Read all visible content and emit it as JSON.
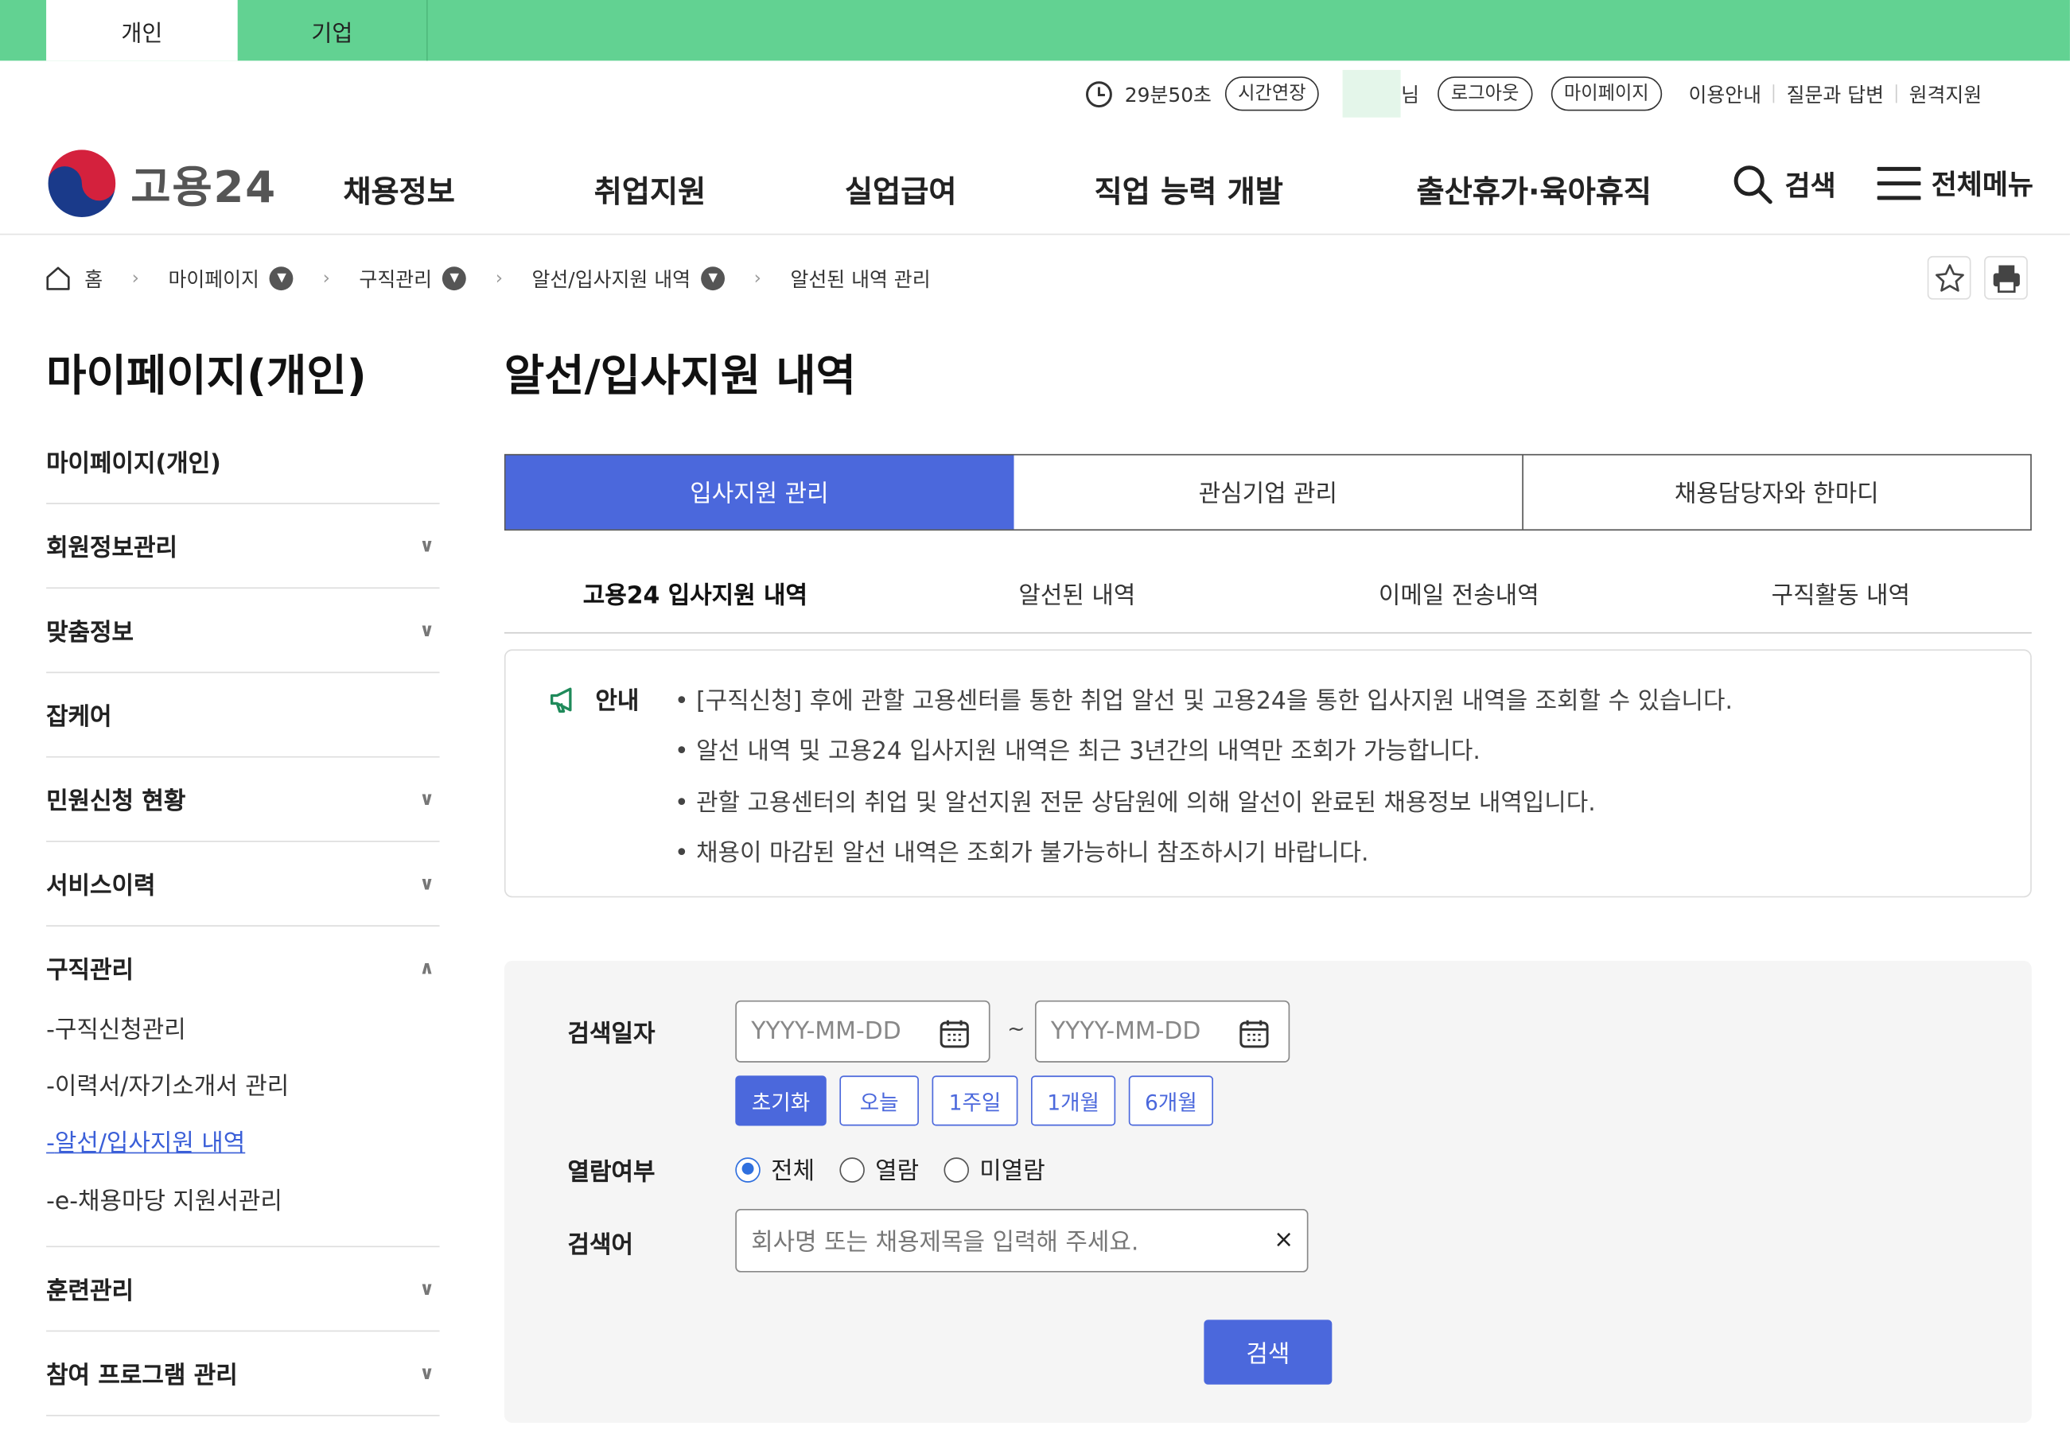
{
  "top_tabs": [
    {
      "label": "개인"
    },
    {
      "label": "기업"
    }
  ],
  "util": {
    "timer": "29분50초",
    "extend": "시간연장",
    "user_suffix": "님",
    "logout": "로그아웃",
    "mypage": "마이페이지",
    "links": [
      "이용안내",
      "질문과 답변",
      "원격지원"
    ]
  },
  "brand": {
    "logo_text": "고용24",
    "logo_colors": [
      "#d4213d",
      "#1a3a8a"
    ]
  },
  "gnb": {
    "items": [
      "채용정보",
      "취업지원",
      "실업급여",
      "직업 능력 개발",
      "출산휴가·육아휴직"
    ],
    "search": "검색",
    "menu": "전체메뉴"
  },
  "breadcrumb": {
    "home": "홈",
    "items": [
      "마이페이지",
      "구직관리",
      "알선/입사지원 내역",
      "알선된 내역 관리"
    ]
  },
  "side": {
    "title": "마이페이지(개인)",
    "items": [
      "마이페이지(개인)",
      "회원정보관리",
      "맞춤정보",
      "잡케어",
      "민원신청 현황",
      "서비스이력",
      "구직관리"
    ],
    "sub_items": [
      "구직신청관리",
      "이력서/자기소개서 관리",
      "알선/입사지원 내역",
      "e-채용마당 지원서관리"
    ],
    "bottom_items": [
      "훈련관리",
      "참여 프로그램 관리"
    ]
  },
  "main": {
    "title": "알선/입사지원 내역",
    "tabs": [
      "입사지원 관리",
      "관심기업 관리",
      "채용담당자와 한마디"
    ],
    "subtabs": [
      "고용24 입사지원 내역",
      "알선된 내역",
      "이메일 전송내역",
      "구직활동 내역"
    ],
    "notice_label": "안내",
    "notice": [
      "[구직신청] 후에 관할 고용센터를 통한 취업 알선 및 고용24을 통한 입사지원 내역을 조회할 수 있습니다.",
      "알선 내역 및 고용24 입사지원 내역은 최근 3년간의 내역만 조회가 가능합니다.",
      "관할 고용센터의 취업 및 알선지원 전문 상담원에 의해 알선이 완료된 채용정보 내역입니다.",
      "채용이 마감된 알선 내역은 조회가 불가능하니 참조하시기 바랍니다."
    ]
  },
  "search": {
    "date_label": "검색일자",
    "date_placeholder": "YYYY-MM-DD",
    "tilde": "~",
    "periods": [
      "초기화",
      "오늘",
      "1주일",
      "1개월",
      "6개월"
    ],
    "read_label": "열람여부",
    "read_options": [
      "전체",
      "열람",
      "미열람"
    ],
    "keyword_label": "검색어",
    "keyword_placeholder": "회사명 또는 채용제목을 입력해 주세요.",
    "clear": "×",
    "button": "검색"
  },
  "colors": {
    "topbar": "#62d292",
    "accent": "#4b68dc"
  }
}
